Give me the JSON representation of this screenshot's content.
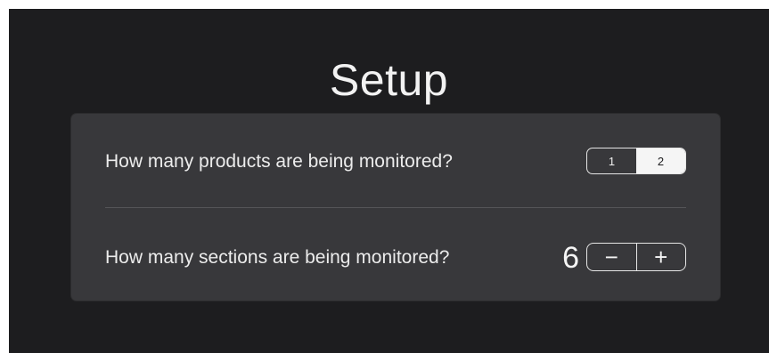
{
  "title": "Setup",
  "questions": [
    {
      "label": "How many products are being monitored?",
      "control": "segmented",
      "options": [
        "1",
        "2"
      ],
      "selected": "2"
    },
    {
      "label": "How many sections are being monitored?",
      "control": "stepper",
      "value": "6",
      "decrement_glyph": "−",
      "increment_glyph": "+"
    }
  ],
  "colors": {
    "background": "#1d1d1f",
    "panel": "#38383b",
    "text": "#ececec",
    "selected_segment": "#f5f5f5"
  },
  "icons": [
    "minus-icon",
    "plus-icon"
  ]
}
